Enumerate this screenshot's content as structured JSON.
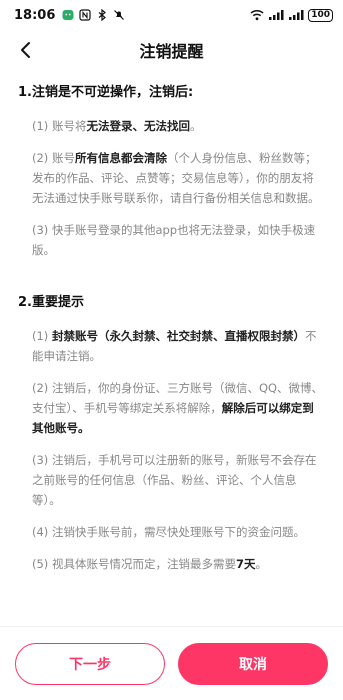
{
  "status_bar": {
    "time": "18:06",
    "battery": "100",
    "left_icons": [
      "wechat-icon",
      "nfc-icon",
      "bluetooth-icon",
      "mute-icon"
    ],
    "right_icons": [
      "wifi-icon",
      "signal-icon",
      "signal-icon",
      "battery-icon"
    ]
  },
  "nav": {
    "back_icon": "chevron-left-icon",
    "title": "注销提醒"
  },
  "section1": {
    "title": "1.注销是不可逆操作，注销后:",
    "items": [
      {
        "p1": "(1) 账号将",
        "b1": "无法登录、无法找回",
        "p2": "。"
      },
      {
        "p1": "(2) 账号",
        "b1": "所有信息都会清除",
        "p2": "（个人身份信息、粉丝数等；发布的作品、评论、点赞等；交易信息等），你的朋友将无法通过快手账号联系你，请自行备份相关信息和数据。"
      },
      {
        "p1": "(3) 快手账号登录的其他app也将无法登录，如快手极速版。"
      }
    ]
  },
  "section2": {
    "title": "2.重要提示",
    "items": [
      {
        "p1": "(1) ",
        "b1": "封禁账号（永久封禁、社交封禁、直播权限封禁）",
        "p2": "不能申请注销。"
      },
      {
        "p1": "(2) 注销后，你的身份证、三方账号（微信、QQ、微博、支付宝）、手机号等绑定关系将解除，",
        "b1": "解除后可以绑定到其他账号。"
      },
      {
        "p1": "(3) 注销后，手机号可以注册新的账号，新账号不会存在之前账号的任何信息（作品、粉丝、评论、个人信息等）。"
      },
      {
        "p1": "(4) 注销快手账号前，需尽快处理账号下的资金问题。"
      },
      {
        "p1": "(5) 视具体账号情况而定，注销最多需要",
        "b1": "7天",
        "p2": "。"
      }
    ]
  },
  "footer": {
    "next_label": "下一步",
    "cancel_label": "取消"
  },
  "colors": {
    "accent": "#fe3666",
    "muted_text": "#888888",
    "strong_text": "#222222"
  }
}
